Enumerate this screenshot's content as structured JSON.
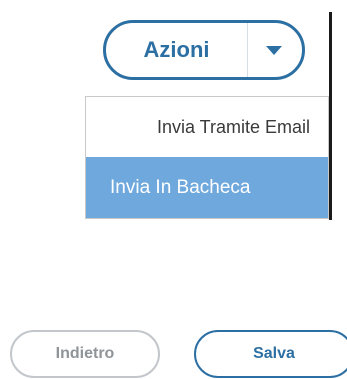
{
  "actions": {
    "label": "Azioni",
    "toggle_icon": "caret-down-icon"
  },
  "menu": {
    "items": [
      {
        "label": "Invia Tramite Email"
      },
      {
        "label": "Invia In Bacheca",
        "active": true
      }
    ]
  },
  "footer": {
    "back_label": "Indietro",
    "save_label": "Salva"
  },
  "colors": {
    "accent": "#2c6fa3",
    "highlight": "#6fa8dc",
    "disabled": "#8f9499"
  }
}
